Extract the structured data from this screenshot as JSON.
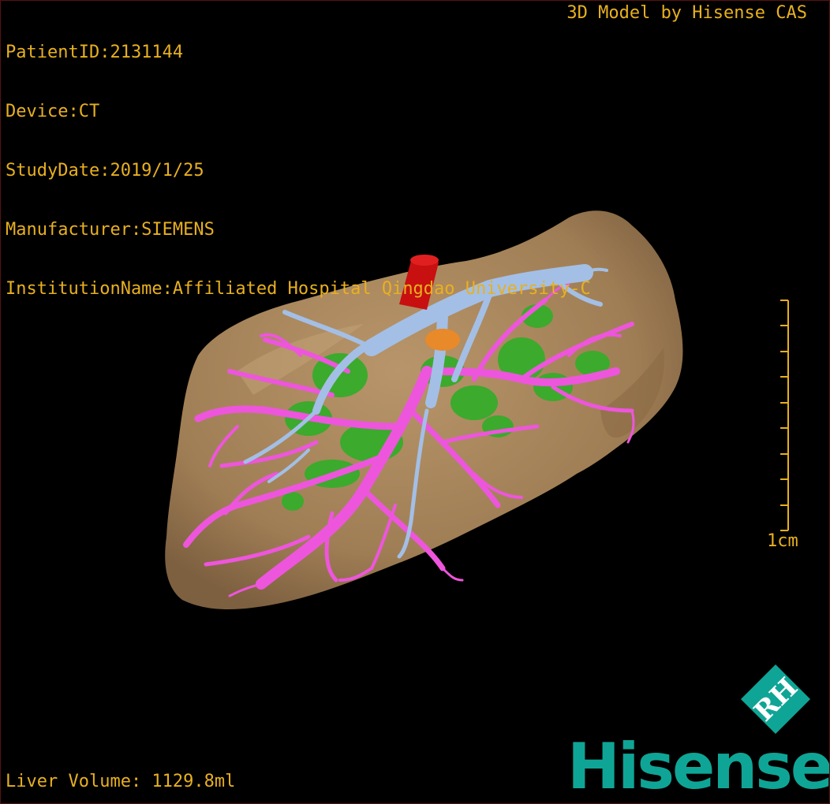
{
  "patient_info": {
    "patient_id": "PatientID:2131144",
    "device": "Device:CT",
    "study_date": "StudyDate:2019/1/25",
    "manufacturer": "Manufacturer:SIEMENS",
    "institution": "InstitutionName:Affiliated Hospital Qingdao University-C"
  },
  "credit": "3D Model by Hisense CAS",
  "scale_bar": {
    "label": "1cm"
  },
  "liver_volume": "Liver Volume: 1129.8ml",
  "logo": {
    "mark_text": "RH",
    "word": "Hisense"
  },
  "colors": {
    "overlay_text": "#e8b020",
    "liver": "#a98659",
    "portal_vein": "#ee55dd",
    "hepatic_vein": "#a3bfe6",
    "artery": "#c81010",
    "lesion": "#3caa2c",
    "brand": "#0fa596"
  },
  "icons": {
    "model": "3d-liver-model",
    "logo_mark": "hisense-rh-diamond-icon"
  }
}
